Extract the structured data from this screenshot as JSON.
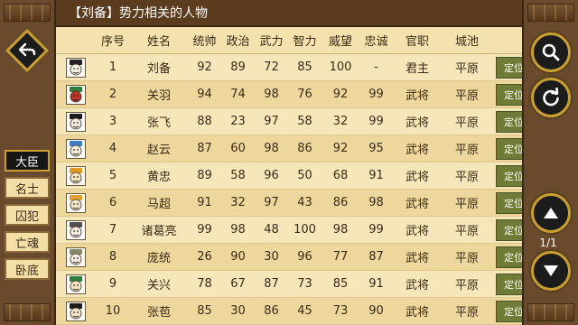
{
  "title": "【刘备】势力相关的人物",
  "columns": [
    "序号",
    "姓名",
    "统帅",
    "政治",
    "武力",
    "智力",
    "威望",
    "忠诚",
    "官职",
    "城池"
  ],
  "side_tabs": [
    {
      "label": "大臣",
      "active": true
    },
    {
      "label": "名士",
      "active": false
    },
    {
      "label": "囚犯",
      "active": false
    },
    {
      "label": "亡魂",
      "active": false
    },
    {
      "label": "卧底",
      "active": false
    }
  ],
  "rows": [
    {
      "no": "1",
      "name": "刘备",
      "lead": "92",
      "pol": "89",
      "war": "72",
      "int": "85",
      "fame": "100",
      "loyal": "-",
      "title": "君主",
      "city": "平原",
      "face": "#f6f2e6",
      "hat": "#222222",
      "locate": "定位"
    },
    {
      "no": "2",
      "name": "关羽",
      "lead": "94",
      "pol": "74",
      "war": "98",
      "int": "76",
      "fame": "92",
      "loyal": "99",
      "title": "武将",
      "city": "平原",
      "face": "#c0342a",
      "hat": "#2f7d3a",
      "locate": "定位"
    },
    {
      "no": "3",
      "name": "张飞",
      "lead": "88",
      "pol": "23",
      "war": "97",
      "int": "58",
      "fame": "32",
      "loyal": "99",
      "title": "武将",
      "city": "平原",
      "face": "#f3ece0",
      "hat": "#1b1b1b",
      "locate": "定位"
    },
    {
      "no": "4",
      "name": "赵云",
      "lead": "87",
      "pol": "60",
      "war": "98",
      "int": "86",
      "fame": "92",
      "loyal": "95",
      "title": "武将",
      "city": "平原",
      "face": "#f4ead8",
      "hat": "#3d7ec8",
      "locate": "定位"
    },
    {
      "no": "5",
      "name": "黄忠",
      "lead": "89",
      "pol": "58",
      "war": "96",
      "int": "50",
      "fame": "68",
      "loyal": "91",
      "title": "武将",
      "city": "平原",
      "face": "#f4e4c0",
      "hat": "#e09a22",
      "locate": "定位"
    },
    {
      "no": "6",
      "name": "马超",
      "lead": "91",
      "pol": "32",
      "war": "97",
      "int": "43",
      "fame": "86",
      "loyal": "98",
      "title": "武将",
      "city": "平原",
      "face": "#f4e6cc",
      "hat": "#e0a030",
      "locate": "定位"
    },
    {
      "no": "7",
      "name": "诸葛亮",
      "lead": "99",
      "pol": "98",
      "war": "48",
      "int": "100",
      "fame": "98",
      "loyal": "99",
      "title": "武将",
      "city": "平原",
      "face": "#f2eee4",
      "hat": "#505050",
      "locate": "定位"
    },
    {
      "no": "8",
      "name": "庞统",
      "lead": "26",
      "pol": "90",
      "war": "30",
      "int": "96",
      "fame": "77",
      "loyal": "87",
      "title": "武将",
      "city": "平原",
      "face": "#f2ede0",
      "hat": "#8a8a6a",
      "locate": "定位"
    },
    {
      "no": "9",
      "name": "关兴",
      "lead": "78",
      "pol": "67",
      "war": "87",
      "int": "73",
      "fame": "85",
      "loyal": "91",
      "title": "武将",
      "city": "平原",
      "face": "#f3e4c8",
      "hat": "#2f7d3a",
      "locate": "定位"
    },
    {
      "no": "10",
      "name": "张苞",
      "lead": "85",
      "pol": "30",
      "war": "86",
      "int": "45",
      "fame": "73",
      "loyal": "90",
      "title": "武将",
      "city": "平原",
      "face": "#f3e4c8",
      "hat": "#1b1b1b",
      "locate": "定位"
    }
  ],
  "page_indicator": "1/1",
  "colors": {
    "panel_bg": "#f4e2ae",
    "title_bar": "#5c3c1e",
    "frame": "#6a4a2c",
    "button_gold": "#c9a030",
    "locate_btn": "#6f7b36"
  },
  "icons": {
    "back": "back-arrow-icon",
    "search": "search-icon",
    "refresh": "refresh-icon",
    "up": "arrow-up-icon",
    "down": "arrow-down-icon"
  }
}
